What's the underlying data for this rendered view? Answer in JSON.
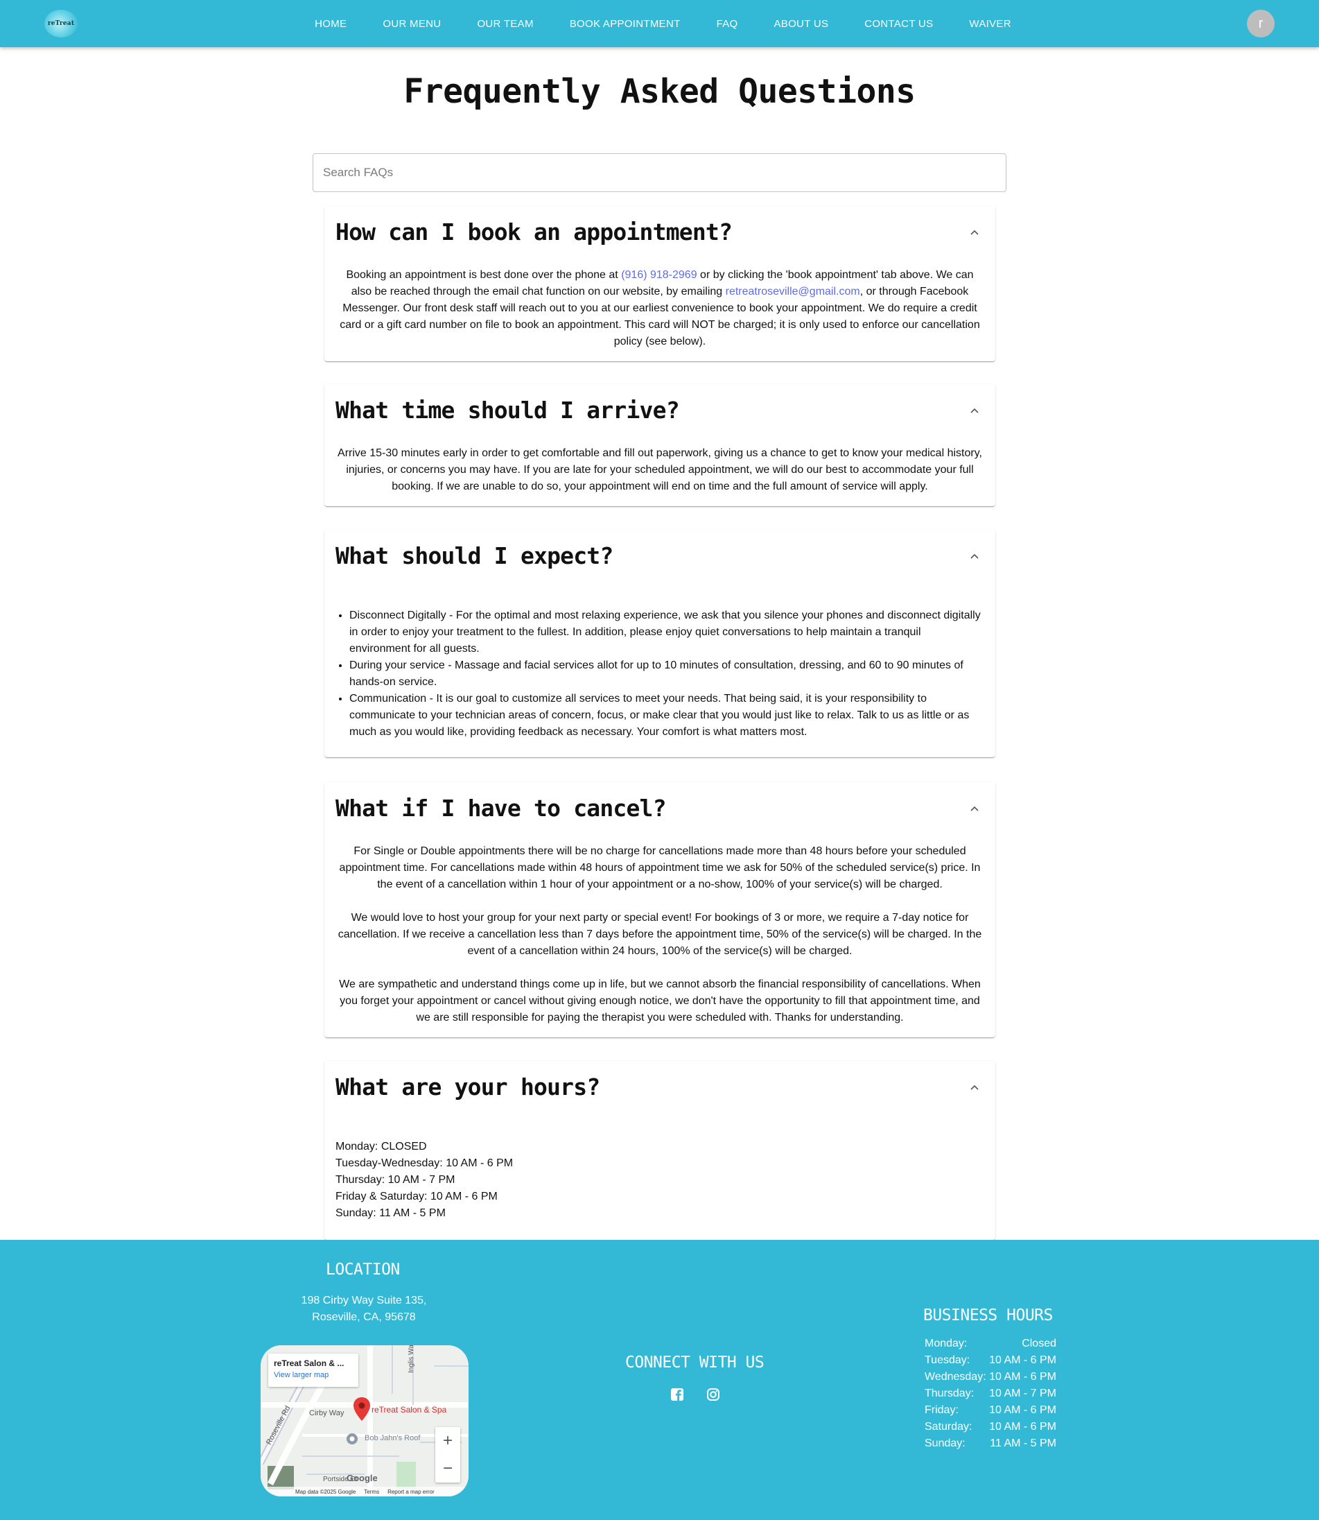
{
  "nav": {
    "logo_text": "reTreat",
    "items": [
      "HOME",
      "OUR MENU",
      "OUR TEAM",
      "BOOK APPOINTMENT",
      "FAQ",
      "ABOUT US",
      "CONTACT US",
      "WAIVER"
    ],
    "avatar_letter": "r"
  },
  "page": {
    "title": "Frequently Asked Questions",
    "search_placeholder": "Search FAQs"
  },
  "faqs": {
    "book": {
      "question": "How can I book an appointment?",
      "t1": "Booking an appointment is best done over the phone at ",
      "phone": "(916) 918-2969",
      "t2": " or by clicking the 'book appointment' tab above. We can also be reached through the email chat function on our website, by emailing ",
      "email": "retreatroseville@gmail.com",
      "t3": ", or through Facebook Messenger. Our front desk staff will reach out to you at our earliest convenience to book your appointment. We do require a credit card or a gift card number on file to book an appointment. This card will NOT be charged; it is only used to enforce our cancellation policy (see below)."
    },
    "arrive": {
      "question": "What time should I arrive?",
      "answer": "Arrive 15-30 minutes early in order to get comfortable and fill out paperwork, giving us a chance to get to know your medical history, injuries, or concerns you may have. If you are late for your scheduled appointment, we will do our best to accommodate your full booking. If we are unable to do so, your appointment will end on time and the full amount of service will apply."
    },
    "expect": {
      "question": "What should I expect?",
      "items": [
        "Disconnect Digitally - For the optimal and most relaxing experience, we ask that you silence your phones and disconnect digitally in order to enjoy your treatment to the fullest. In addition, please enjoy quiet conversations to help maintain a tranquil environment for all guests.",
        "During your service - Massage and facial services allot for up to 10 minutes of consultation, dressing, and 60 to 90 minutes of hands-on service.",
        "Communication - It is our goal to customize all services to meet your needs. That being said, it is your responsibility to communicate to your technician areas of concern, focus, or make clear that you would just like to relax. Talk to us as little or as much as you would like, providing feedback as necessary. Your comfort is what matters most."
      ]
    },
    "cancel": {
      "question": "What if I have to cancel?",
      "p1": "For Single or Double appointments there will be no charge for cancellations made more than 48 hours before your scheduled appointment time. For cancellations made within 48 hours of appointment time we ask for 50% of the scheduled service(s) price. In the event of a cancellation within 1 hour of your appointment or a no-show, 100% of your service(s) will be charged.",
      "p2": "We would love to host your group for your next party or special event! For bookings of 3 or more, we require a 7-day notice for cancellation. If we receive a cancellation less than 7 days before the appointment time, 50% of the service(s) will be charged. In the event of a cancellation within 24 hours, 100% of the service(s) will be charged.",
      "p3": "We are sympathetic and understand things come up in life, but we cannot absorb the financial responsibility of cancellations. When you forget your appointment or cancel without giving enough notice, we don't have the opportunity to fill that appointment time, and we are still responsible for paying the therapist you were scheduled with. Thanks for understanding."
    },
    "hours": {
      "question": "What are your hours?",
      "lines": [
        "Monday: CLOSED",
        "Tuesday-Wednesday: 10 AM - 6 PM",
        "Thursday: 10 AM - 7 PM",
        "Friday & Saturday: 10 AM - 6 PM",
        "Sunday: 11 AM - 5 PM"
      ]
    }
  },
  "footer": {
    "location_title": "LOCATION",
    "address_line1": "198 Cirby Way Suite 135,",
    "address_line2": "Roseville, CA, 95678",
    "connect_title": "CONNECT WITH US",
    "social_icons": [
      "facebook-icon",
      "instagram-icon"
    ],
    "hours_title": "BUSINESS HOURS",
    "hours": [
      {
        "day": "Monday:",
        "time": "Closed"
      },
      {
        "day": "Tuesday:",
        "time": "10 AM - 6 PM"
      },
      {
        "day": "Wednesday:",
        "time": "10 AM - 6 PM"
      },
      {
        "day": "Thursday:",
        "time": "10 AM - 7 PM"
      },
      {
        "day": "Friday:",
        "time": "10 AM - 6 PM"
      },
      {
        "day": "Saturday:",
        "time": "10 AM - 6 PM"
      },
      {
        "day": "Sunday:",
        "time": "11 AM - 5 PM"
      }
    ],
    "map": {
      "place_name": "reTreat Salon & ...",
      "view_larger": "View larger map",
      "pin_label": "reTreat Salon & Spa",
      "street1": "Cirby Way",
      "street2": "Roseville Rd",
      "street3": "Inglis Way",
      "poi": "Bob Jahn's Roof",
      "portside": "Portside Ct",
      "google": "Google",
      "credit1": "Map data ©2025 Google",
      "credit2": "Terms",
      "credit3": "Report a map error"
    }
  },
  "colors": {
    "brand": "#33b9d6",
    "link": "#5d6ce3",
    "pin": "#e53935"
  }
}
